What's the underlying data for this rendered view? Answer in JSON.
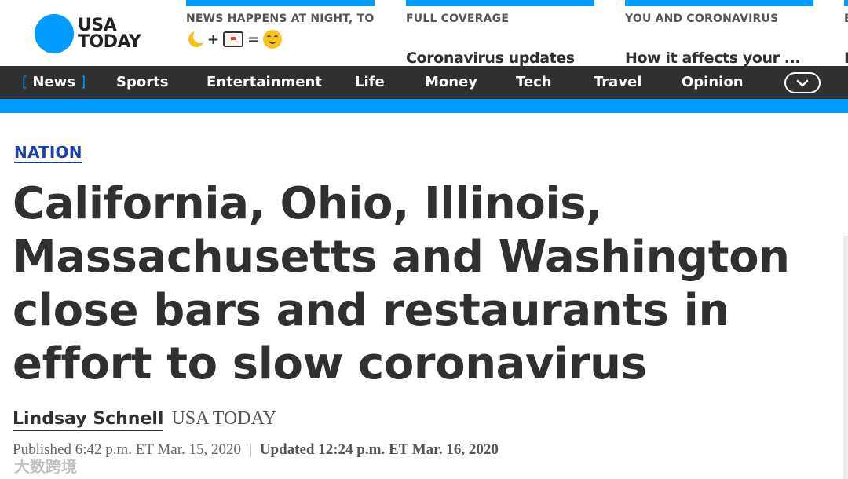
{
  "brand": {
    "logo_line1": "USA",
    "logo_line2": "TODAY"
  },
  "promos": [
    {
      "kicker": "NEWS HAPPENS AT NIGHT, TOO",
      "headline_symbols": [
        "+",
        "="
      ]
    },
    {
      "kicker": "FULL COVERAGE",
      "headline": "Coronavirus updates"
    },
    {
      "kicker": "YOU AND CORONAVIRUS",
      "headline": "How it affects your ..."
    },
    {
      "kicker": "E",
      "headline": "E"
    }
  ],
  "nav": {
    "items": [
      "News",
      "Sports",
      "Entertainment",
      "Life",
      "Money",
      "Tech",
      "Travel",
      "Opinion"
    ],
    "active_bracket_left": "[",
    "active_bracket_right": "]"
  },
  "article": {
    "section": "NATION",
    "headline": "California, Ohio, Illinois, Massachusetts and Washington close bars and restaurants in effort to slow coronavirus",
    "author": "Lindsay Schnell",
    "outlet": "USA TODAY",
    "published": "Published 6:42 p.m. ET Mar. 15, 2020",
    "separator": "|",
    "updated": "Updated 12:24 p.m. ET Mar. 16, 2020"
  },
  "watermark": "大数跨境",
  "colors": {
    "brand_blue": "#009bff",
    "nav_bg": "#303030",
    "section_link": "#1a3fa8"
  },
  "icons": [
    "moon-icon",
    "tv-icon",
    "smile-face-icon",
    "chevron-down-icon"
  ]
}
